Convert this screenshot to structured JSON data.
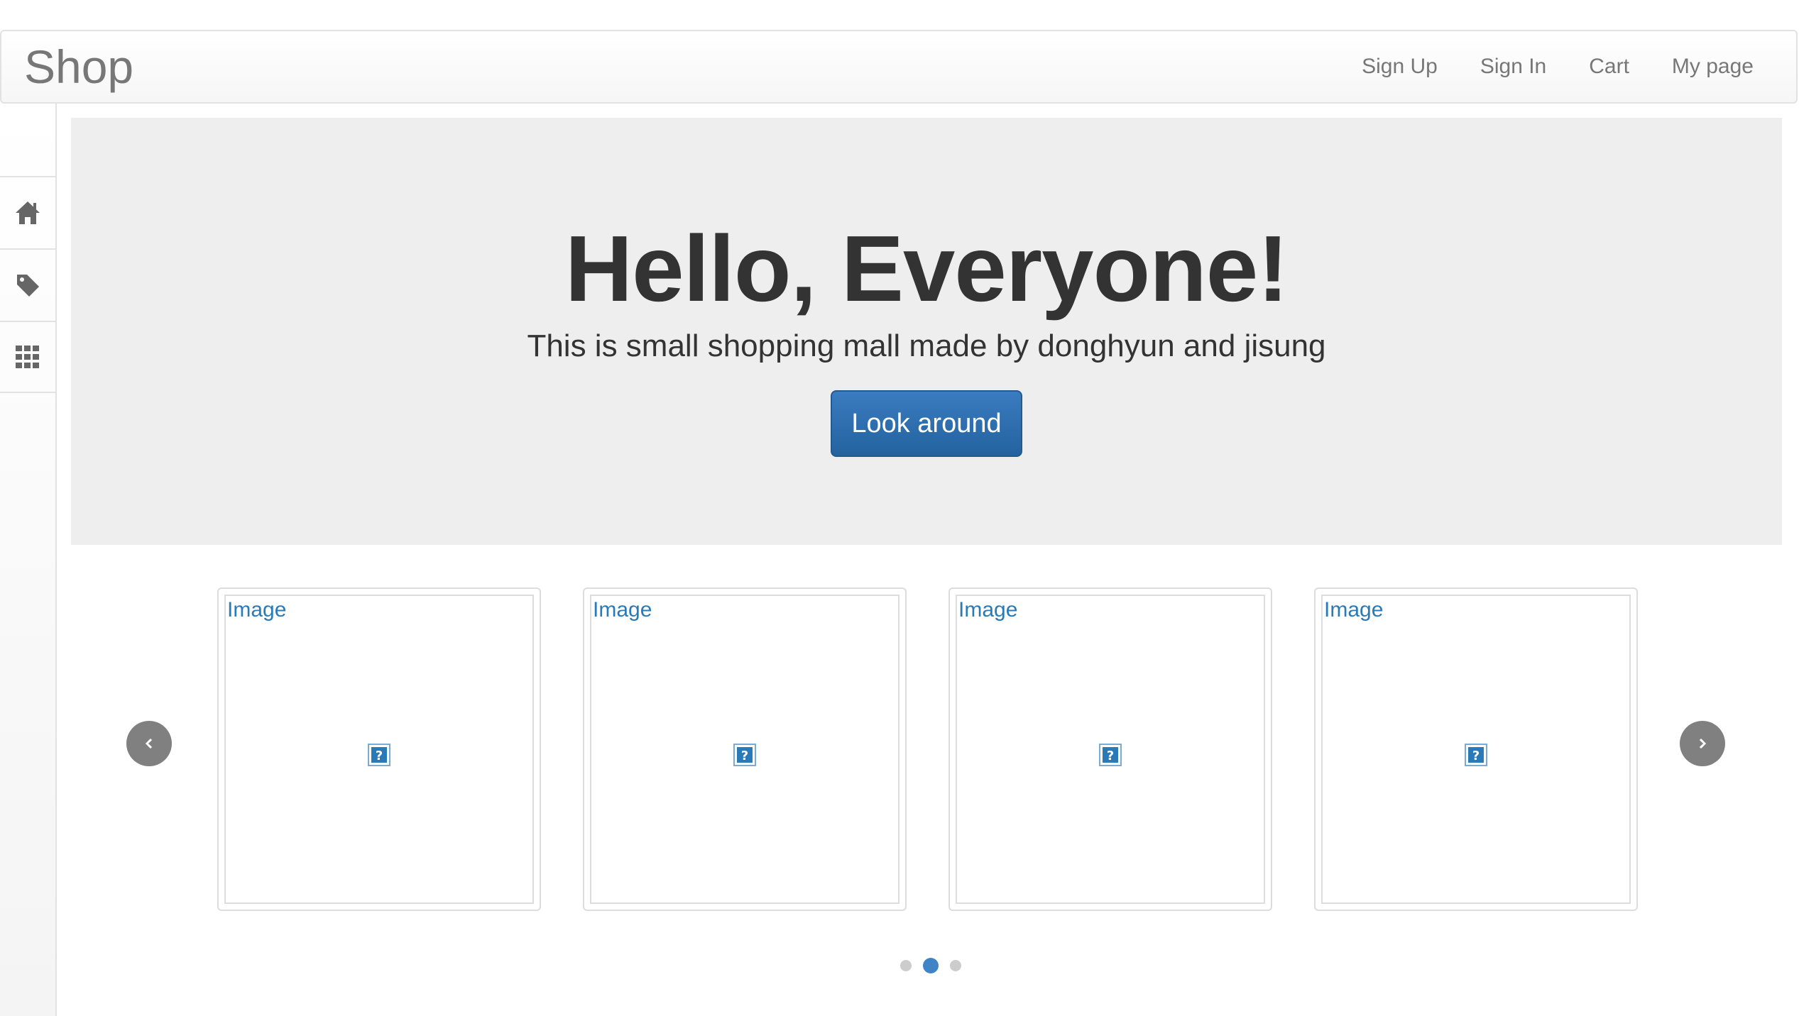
{
  "navbar": {
    "brand": "Shop",
    "links": [
      "Sign Up",
      "Sign In",
      "Cart",
      "My page"
    ]
  },
  "sidebar": {
    "items": [
      {
        "icon": "home-icon"
      },
      {
        "icon": "tag-icon"
      },
      {
        "icon": "grid-icon"
      }
    ]
  },
  "hero": {
    "title": "Hello, Everyone!",
    "subtitle": "This is small shopping mall made by donghyun and jisung",
    "button_label": "Look around"
  },
  "carousel": {
    "cards": [
      {
        "alt": "Image"
      },
      {
        "alt": "Image"
      },
      {
        "alt": "Image"
      },
      {
        "alt": "Image"
      }
    ],
    "prev_icon": "chevron-left-icon",
    "next_icon": "chevron-right-icon",
    "dots_total": 3,
    "active_dot": 2
  },
  "colors": {
    "primary": "#2a6aab",
    "link": "#2a7ab8",
    "jumbotron_bg": "#eeeeee",
    "nav_text": "#777777"
  }
}
